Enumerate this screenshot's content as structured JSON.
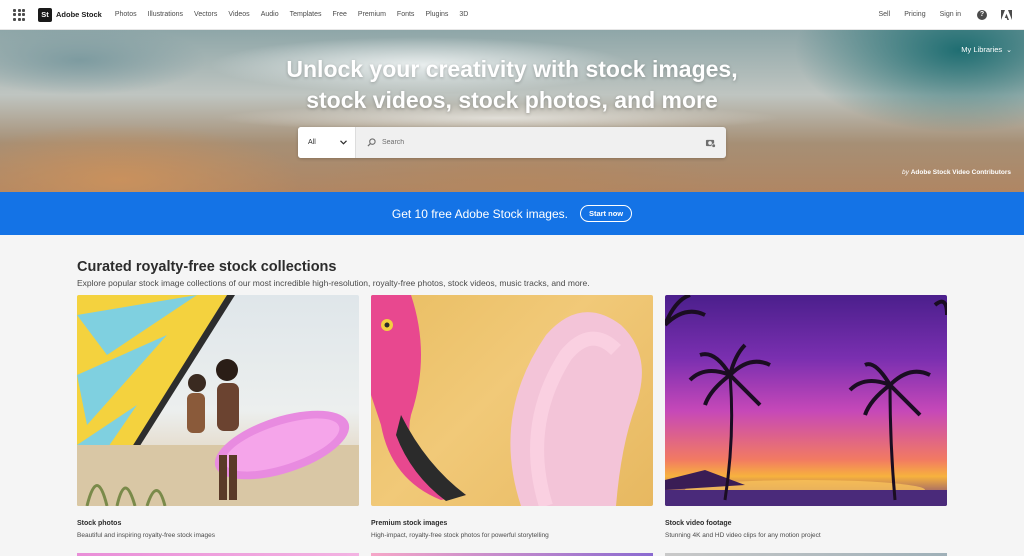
{
  "nav": {
    "brand": "Adobe Stock",
    "brand_logo": "St",
    "links": [
      "Photos",
      "Illustrations",
      "Vectors",
      "Videos",
      "Audio",
      "Templates",
      "Free",
      "Premium",
      "Fonts",
      "Plugins",
      "3D"
    ],
    "right_links": [
      "Sell",
      "Pricing",
      "Sign in"
    ],
    "icons": [
      "apps-grid-icon",
      "help-icon",
      "adobe-logo-icon"
    ]
  },
  "hero": {
    "title_line1": "Unlock your creativity with stock images,",
    "title_line2": "stock videos, stock photos, and more",
    "my_libraries": "My Libraries",
    "search": {
      "scope": "All",
      "placeholder": "Search"
    },
    "credit_prefix": "by",
    "credit_name": "Adobe Stock Video Contributors"
  },
  "promo": {
    "text": "Get 10 free Adobe Stock images.",
    "button": "Start now",
    "color": "#1473e6"
  },
  "collections": {
    "title": "Curated royalty-free stock collections",
    "subtitle": "Explore popular stock image collections of our most incredible high-resolution, royalty-free photos, stock videos, music tracks, and more.",
    "cards": [
      {
        "title": "Stock photos",
        "desc": "Beautiful and inspiring royalty-free stock images"
      },
      {
        "title": "Premium stock images",
        "desc": "High-impact, royalty-free stock photos for powerful storytelling"
      },
      {
        "title": "Stock video footage",
        "desc": "Stunning 4K and HD video clips for any motion project"
      }
    ]
  }
}
